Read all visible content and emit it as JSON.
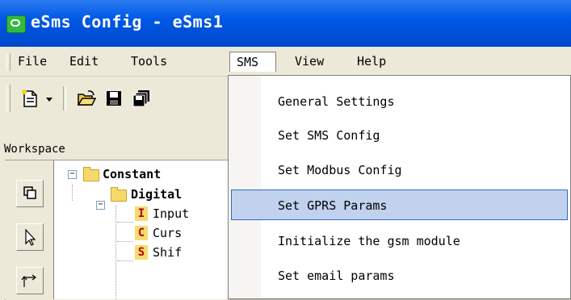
{
  "window": {
    "title": "eSms Config - eSms1"
  },
  "menubar": {
    "items": [
      "File",
      "Edit",
      "Tools",
      "SMS",
      "View",
      "Help"
    ],
    "open_index": 3
  },
  "toolbar": {
    "icons": [
      "new-file-icon",
      "dropdown-arrow-icon",
      "open-folder-icon",
      "save-icon",
      "save-all-icon"
    ]
  },
  "workspace": {
    "label": "Workspace",
    "side_icons": [
      "window-icon",
      "pointer-arrow-icon",
      "connect-arrow-icon"
    ],
    "tree": {
      "root": "Constant",
      "child": "Digital",
      "leaves": [
        {
          "badge": "I",
          "label": "Input",
          "badge_color": "#c00000"
        },
        {
          "badge": "C",
          "label": "Curs",
          "badge_color": "#c00000"
        },
        {
          "badge": "S",
          "label": "Shif",
          "badge_color": "#c00000"
        }
      ]
    }
  },
  "sms_menu": {
    "items": [
      "General Settings",
      "Set SMS Config",
      "Set Modbus Config",
      "Set GPRS Params",
      "Initialize the gsm module",
      "Set email params"
    ],
    "highlighted_index": 3
  },
  "colors": {
    "title_bar": "#0058e6",
    "highlight": "#c1d2ee",
    "highlight_border": "#316ac5",
    "menu_bg": "#ece9d8"
  }
}
